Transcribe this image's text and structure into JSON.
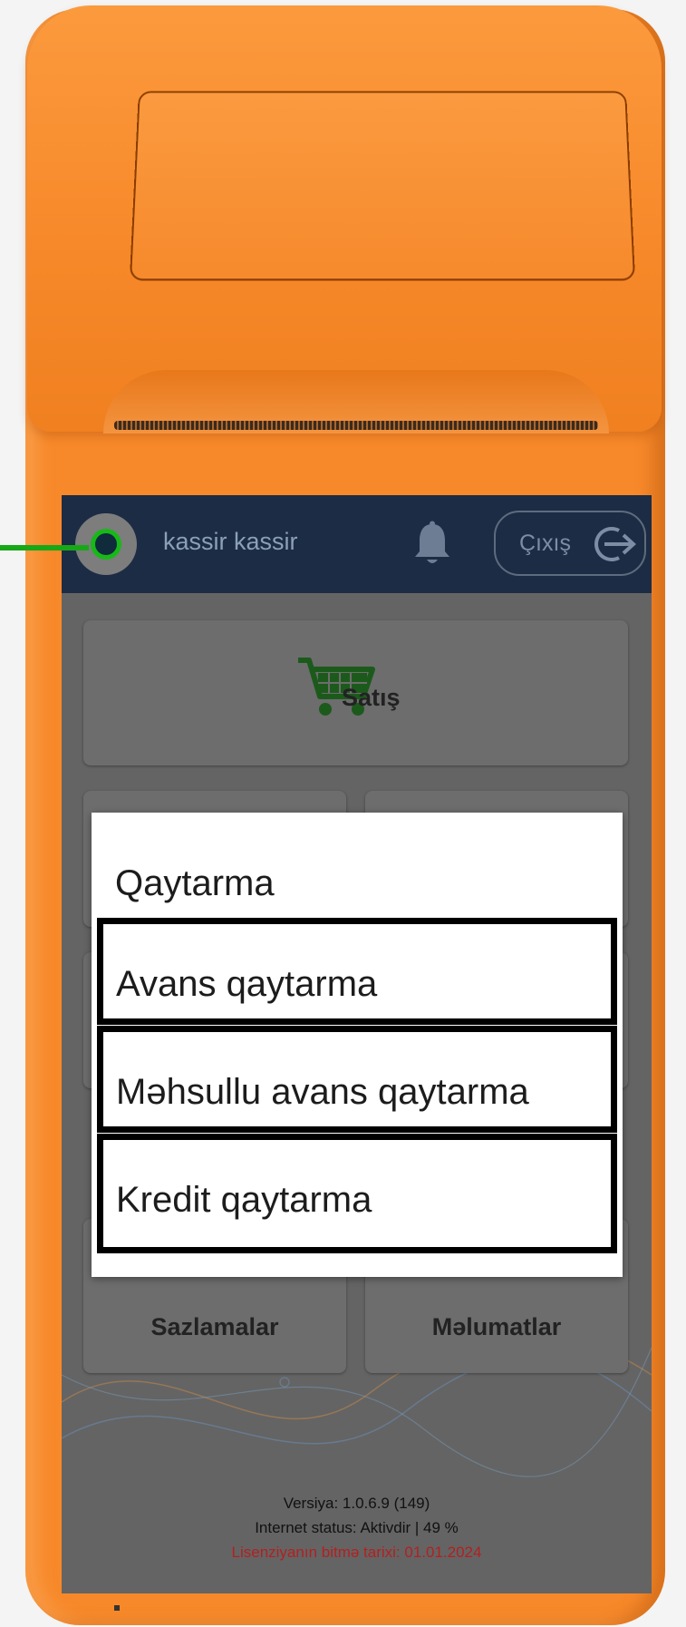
{
  "header": {
    "user_name": "kassir kassir",
    "logout_label": "Çıxış",
    "icons": [
      "user-avatar-icon",
      "bell-icon",
      "logout-arrow-icon"
    ]
  },
  "menu": {
    "tiles": [
      {
        "label": "Satış",
        "icon": "shopping-cart-icon"
      },
      {
        "label": "Sazlamalar",
        "icon": "gear-icon"
      },
      {
        "label": "Məlumatlar",
        "icon": "info-icon"
      }
    ]
  },
  "dialog": {
    "title": "Qaytarma",
    "options": [
      "Avans qaytarma",
      "Məhsullu avans qaytarma",
      "Kredit qaytarma"
    ]
  },
  "footer": {
    "version": "Versiya: 1.0.6.9 (149)",
    "internet_status": "Internet status: Aktivdir | 49 %",
    "license_expiry": "Lisenziyanın bitmə tarixi: 01.01.2024"
  },
  "colors": {
    "device_orange": "#f7892a",
    "header_navy": "#1c2c44",
    "overlay_gray": "#646464",
    "accent_green": "#18b818",
    "license_red": "#b32020"
  }
}
